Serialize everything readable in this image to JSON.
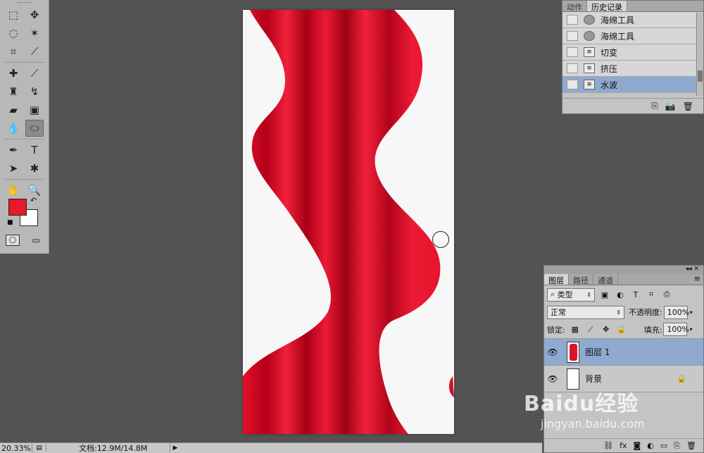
{
  "toolbox": {
    "tools": [
      [
        "rect-marquee",
        "move"
      ],
      [
        "lasso",
        "magic-wand"
      ],
      [
        "crop",
        "eyedropper"
      ],
      [
        "healing-brush",
        "brush"
      ],
      [
        "clone-stamp",
        "history-brush"
      ],
      [
        "eraser",
        "gradient"
      ],
      [
        "blur",
        "sponge"
      ],
      [
        "pen",
        "type"
      ],
      [
        "path-select",
        "custom-shape"
      ],
      [
        "hand",
        "zoom"
      ]
    ],
    "type_tool_glyph": "T",
    "fg_color": "#e8192c",
    "bg_color": "#ffffff"
  },
  "history": {
    "tabs": [
      "动作",
      "历史记录"
    ],
    "active_tab": "历史记录",
    "items": [
      {
        "label": "海绵工具",
        "icon": "sponge-icon",
        "selected": false
      },
      {
        "label": "海绵工具",
        "icon": "sponge-icon",
        "selected": false
      },
      {
        "label": "切变",
        "icon": "history-state-icon",
        "selected": false
      },
      {
        "label": "挤压",
        "icon": "history-state-icon",
        "selected": false
      },
      {
        "label": "水波",
        "icon": "history-state-icon",
        "selected": true
      }
    ]
  },
  "layers": {
    "tabs": [
      "图层",
      "路径",
      "通道"
    ],
    "active_tab": "图层",
    "filter_label": "类型",
    "blend_mode": "正常",
    "opacity_label": "不透明度:",
    "opacity_value": "100%",
    "lock_label": "锁定:",
    "fill_label": "填充:",
    "fill_value": "100%",
    "items": [
      {
        "name": "图层 1",
        "selected": true,
        "thumb": "red"
      },
      {
        "name": "背景",
        "selected": false,
        "thumb": "white"
      }
    ]
  },
  "statusbar": {
    "zoom": "20.33%",
    "doc_size": "文档:12.9M/14.8M"
  },
  "watermark": {
    "title": "Baidu经验",
    "url": "jingyan.baidu.com"
  },
  "colors": {
    "workspace": "#535353",
    "ribbon_red": "#e0102a",
    "selection_blue": "#8fa9cf"
  }
}
